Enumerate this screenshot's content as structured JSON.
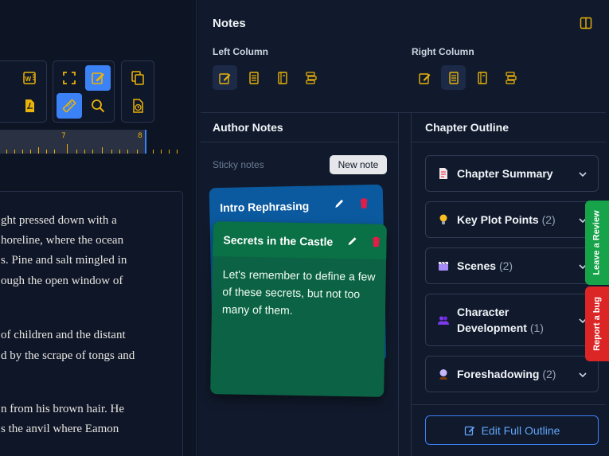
{
  "toolbar": {
    "icons": [
      "word-export-icon",
      "pdf-export-icon",
      "fullscreen-icon",
      "edit-icon",
      "ruler-icon",
      "search-icon",
      "copy-icon",
      "history-icon"
    ]
  },
  "ruler": {
    "labels": [
      "7",
      "8"
    ]
  },
  "document": {
    "lines": [
      "ght pressed down with a",
      "horeline, where the ocean",
      "s. Pine and salt mingled in",
      "ough the open window of",
      "",
      " of children and the distant",
      "d by the scrape of tongs and",
      "",
      "n from his brown hair. He",
      "s the anvil where Eamon"
    ]
  },
  "notes_panel": {
    "title": "Notes",
    "left_column_label": "Left Column",
    "right_column_label": "Right Column",
    "left_selected": 0,
    "right_selected": 1
  },
  "author_notes": {
    "title": "Author Notes",
    "sticky_label": "Sticky notes",
    "new_note_label": "New note",
    "notes": [
      {
        "title": "Intro Rephrasing",
        "color": "#0b5aa0",
        "body": ""
      },
      {
        "title": "Secrets in the Castle",
        "color": "#0c6244",
        "body": "Let's remember to define a few of these secrets, but not too many of them."
      }
    ]
  },
  "chapter_outline": {
    "title": "Chapter Outline",
    "sections": [
      {
        "label": "Chapter Summary",
        "count": "",
        "icon": "document-icon"
      },
      {
        "label": "Key Plot Points",
        "count": "(2)",
        "icon": "lightbulb-icon"
      },
      {
        "label": "Scenes",
        "count": "(2)",
        "icon": "clapperboard-icon"
      },
      {
        "label": "Character Development",
        "count": "(1)",
        "icon": "people-icon"
      },
      {
        "label": "Foreshadowing",
        "count": "(2)",
        "icon": "crystal-ball-icon"
      }
    ],
    "edit_button_label": "Edit Full Outline"
  },
  "side_tabs": {
    "review": "Leave a Review",
    "bug": "Report a bug"
  },
  "colors": {
    "accent": "#3b82f6",
    "icon_gold": "#eab308",
    "review_green": "#16a34a",
    "bug_red": "#dc2626"
  }
}
